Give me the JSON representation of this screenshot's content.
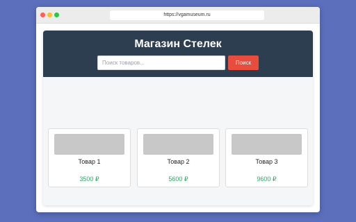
{
  "browser": {
    "url": "https://vgamuseum.ru"
  },
  "header": {
    "title": "Магазин Стелек",
    "search_placeholder": "Поиск товаров...",
    "search_button": "Поиск"
  },
  "products": [
    {
      "name": "Товар 1",
      "price": "3500 ₽"
    },
    {
      "name": "Товар 2",
      "price": "5600 ₽"
    },
    {
      "name": "Товар 3",
      "price": "9600 ₽"
    }
  ],
  "colors": {
    "header_bg": "#2c3e50",
    "accent": "#e74c3c",
    "price": "#27ae60",
    "background": "#5b6fbd"
  }
}
